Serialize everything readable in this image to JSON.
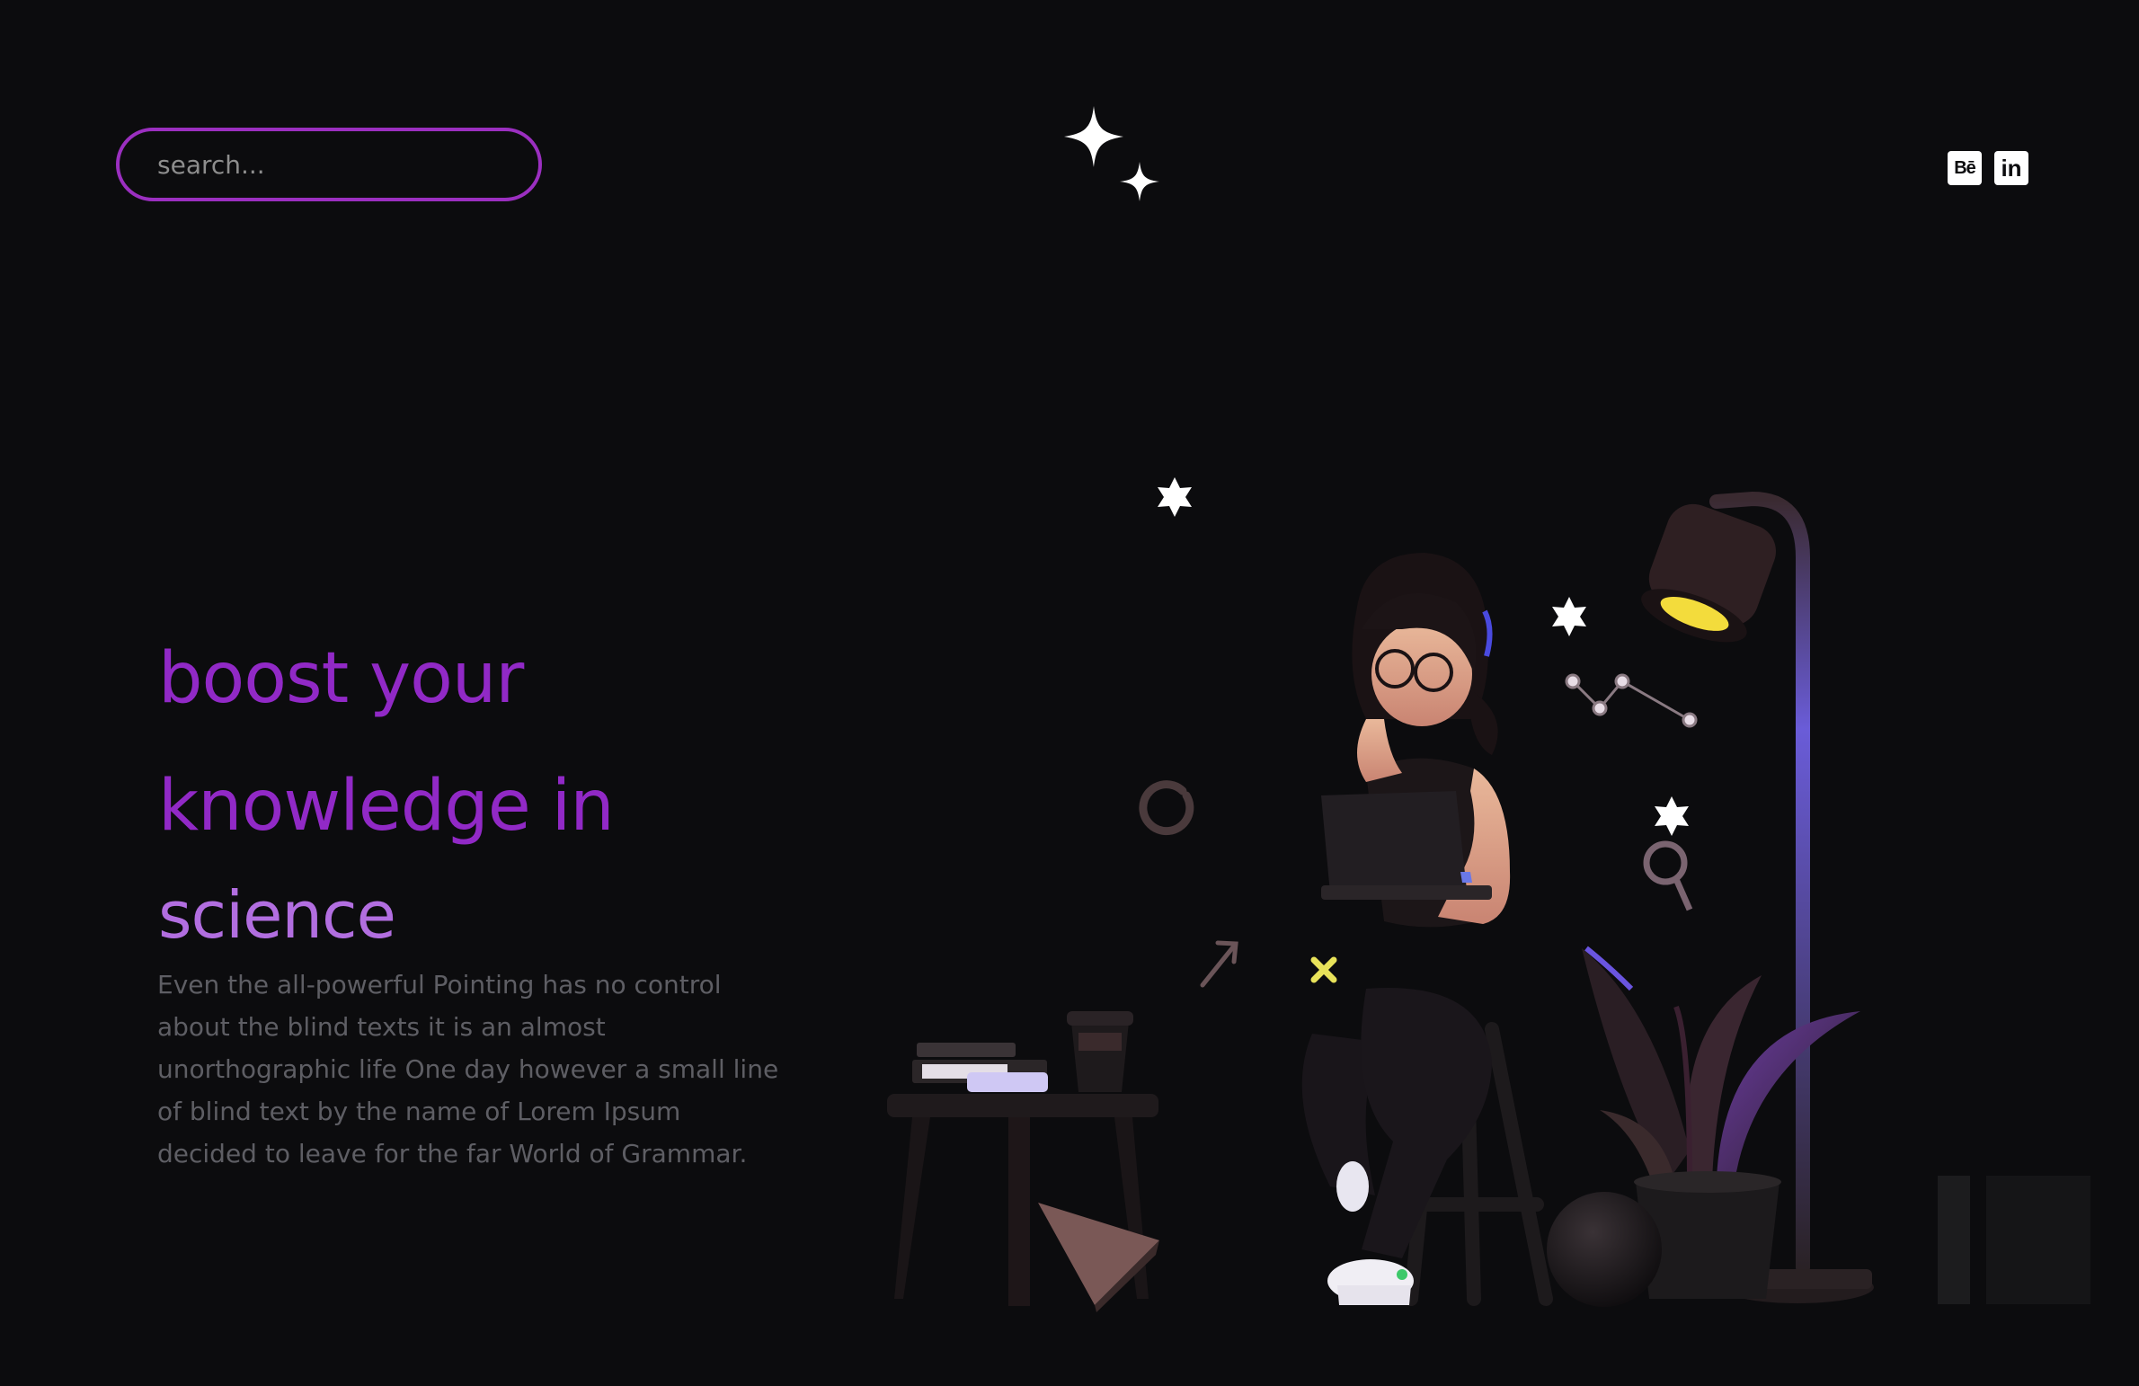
{
  "header": {
    "search": {
      "placeholder": "search..."
    },
    "logo_icon": "sparkle-logo-icon",
    "social": [
      {
        "label": "Bē",
        "icon": "behance-icon"
      },
      {
        "label": "in",
        "icon": "linkedin-icon"
      }
    ]
  },
  "hero": {
    "title_line1": "boost your",
    "title_line2": "knowledge in",
    "title_line3": "science",
    "paragraph": "Even the all-powerful Pointing has no control about the blind texts it is an almost unorthographic life One day however a small line of blind text by the name of Lorem Ipsum decided to leave for the far World of Grammar."
  },
  "colors": {
    "background": "#0c0c0e",
    "accent": "#9129c6",
    "accent_light": "#b26ee0",
    "search_border": "#9b2fc0",
    "body_text": "#5e5e64"
  }
}
